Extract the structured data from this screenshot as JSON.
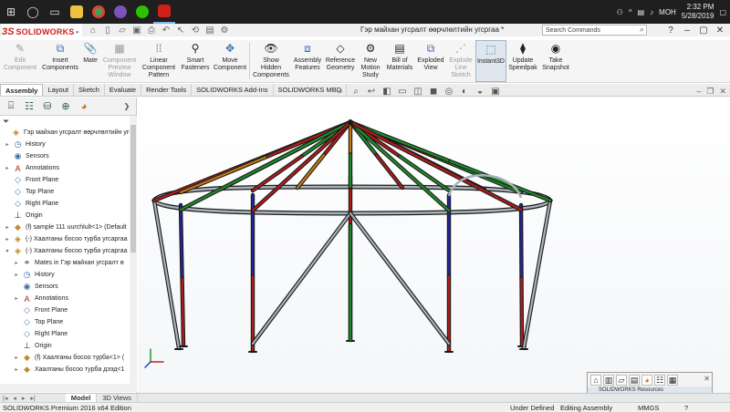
{
  "taskbar": {
    "apps": [
      {
        "name": "windows-start-icon",
        "color": "#ffffff"
      },
      {
        "name": "cortana-icon",
        "color": "#ffffff"
      },
      {
        "name": "task-view-icon",
        "color": "#ffffff"
      },
      {
        "name": "file-explorer-icon",
        "color": "#f0c040"
      },
      {
        "name": "chrome-icon",
        "color": "#3aa757"
      },
      {
        "name": "viber-icon",
        "color": "#7d52b8"
      },
      {
        "name": "wechat-icon",
        "color": "#2dc100"
      },
      {
        "name": "solidworks-icon",
        "color": "#d0201c"
      }
    ],
    "tray": {
      "lang": "MOH",
      "time": "2:32 PM",
      "date": "5/28/2019"
    }
  },
  "window": {
    "brand": "SOLIDWORKS",
    "title": "Гэр майхан угсралт өөрчлөлтийн угсргаа *",
    "search_placeholder": "Search Commands"
  },
  "ribbon": {
    "buttons": [
      {
        "id": "edit-component",
        "label": "Edit Component",
        "icon": "pencil-icon",
        "disabled": true
      },
      {
        "id": "insert-components",
        "label": "Insert Components",
        "icon": "insert-component-icon",
        "disabled": false
      },
      {
        "id": "mate",
        "label": "Mate",
        "icon": "paperclip-icon",
        "disabled": false
      },
      {
        "id": "component-preview",
        "label": "Component Preview Window",
        "icon": "preview-window-icon",
        "disabled": true
      },
      {
        "id": "linear-pattern",
        "label": "Linear Component Pattern",
        "icon": "linear-pattern-icon",
        "disabled": false
      },
      {
        "id": "smart-fasteners",
        "label": "Smart Fasteners",
        "icon": "fastener-icon",
        "disabled": false
      },
      {
        "id": "move-component",
        "label": "Move Component",
        "icon": "move-component-icon",
        "disabled": false
      },
      {
        "id": "show-hidden",
        "label": "Show Hidden Components",
        "icon": "show-hidden-icon",
        "disabled": false
      },
      {
        "id": "assembly-features",
        "label": "Assembly Features",
        "icon": "assembly-features-icon",
        "disabled": false
      },
      {
        "id": "reference-geometry",
        "label": "Reference Geometry",
        "icon": "reference-geometry-icon",
        "disabled": false
      },
      {
        "id": "new-motion-study",
        "label": "New Motion Study",
        "icon": "motion-study-icon",
        "disabled": false
      },
      {
        "id": "bill-of-materials",
        "label": "Bill of Materials",
        "icon": "bom-icon",
        "disabled": false
      },
      {
        "id": "exploded-view",
        "label": "Exploded View",
        "icon": "exploded-view-icon",
        "disabled": false
      },
      {
        "id": "explode-line-sketch",
        "label": "Explode Line Sketch",
        "icon": "explode-line-icon",
        "disabled": true
      },
      {
        "id": "instant3d",
        "label": "Instant3D",
        "icon": "instant3d-icon",
        "disabled": false,
        "active": true
      },
      {
        "id": "update-speedpak",
        "label": "Update Speedpak",
        "icon": "speedpak-icon",
        "disabled": false
      },
      {
        "id": "take-snapshot",
        "label": "Take Snapshot",
        "icon": "camera-icon",
        "disabled": false
      }
    ]
  },
  "command_tabs": [
    "Assembly",
    "Layout",
    "Sketch",
    "Evaluate",
    "Render Tools",
    "SOLIDWORKS Add-Ins",
    "SOLIDWORKS MBD"
  ],
  "command_tab_selected": 0,
  "tree": {
    "items": [
      {
        "label": "Гэр майхан угсралт өөрчлөлтийн угса",
        "level": 0,
        "expander": "",
        "icon": "assembly-icon"
      },
      {
        "label": "History",
        "level": 1,
        "expander": "▸",
        "icon": "history-icon"
      },
      {
        "label": "Sensors",
        "level": 1,
        "expander": "",
        "icon": "sensor-icon"
      },
      {
        "label": "Annotations",
        "level": 1,
        "expander": "▸",
        "icon": "annotation-icon"
      },
      {
        "label": "Front Plane",
        "level": 1,
        "expander": "",
        "icon": "plane-icon"
      },
      {
        "label": "Top Plane",
        "level": 1,
        "expander": "",
        "icon": "plane-icon"
      },
      {
        "label": "Right Plane",
        "level": 1,
        "expander": "",
        "icon": "plane-icon"
      },
      {
        "label": "Origin",
        "level": 1,
        "expander": "",
        "icon": "origin-icon"
      },
      {
        "label": "(f) sample 111 uurchlult<1> (Default",
        "level": 1,
        "expander": "▸",
        "icon": "part-icon"
      },
      {
        "label": "(-) Хаалганы босоо турба угсаргаа",
        "level": 1,
        "expander": "▸",
        "icon": "subassembly-icon"
      },
      {
        "label": "(-) Хаалганы босоо турба угсаргаа",
        "level": 1,
        "expander": "▾",
        "icon": "subassembly-icon"
      },
      {
        "label": "Mates in Гэр майхан угсралт ө",
        "level": 2,
        "expander": "▸",
        "icon": "mates-icon"
      },
      {
        "label": "History",
        "level": 2,
        "expander": "▸",
        "icon": "history-icon"
      },
      {
        "label": "Sensors",
        "level": 2,
        "expander": "",
        "icon": "sensor-icon"
      },
      {
        "label": "Annotations",
        "level": 2,
        "expander": "▸",
        "icon": "annotation-icon"
      },
      {
        "label": "Front Plane",
        "level": 2,
        "expander": "",
        "icon": "plane-icon"
      },
      {
        "label": "Top Plane",
        "level": 2,
        "expander": "",
        "icon": "plane-icon"
      },
      {
        "label": "Right Plane",
        "level": 2,
        "expander": "",
        "icon": "plane-icon"
      },
      {
        "label": "Origin",
        "level": 2,
        "expander": "",
        "icon": "origin-icon"
      },
      {
        "label": "(f) Хаалганы босоо турба<1> (",
        "level": 2,
        "expander": "▸",
        "icon": "part-icon"
      },
      {
        "label": "Хаалганы босоо турба дээд<1",
        "level": 2,
        "expander": "▸",
        "icon": "part-icon"
      }
    ]
  },
  "bottom_tabs": [
    "Model",
    "3D Views"
  ],
  "bottom_tab_selected": 0,
  "status": {
    "edition": "SOLIDWORKS Premium 2016 x64 Edition",
    "state": "Under Defined",
    "mode": "Editing Assembly",
    "units": "MMGS"
  },
  "task_pane": {
    "title": "SOLIDWORKS Resources"
  },
  "colors": {
    "frame": "#1a1a1a",
    "rafter_red": "#b01c1c",
    "rafter_green": "#1e8a2a",
    "rafter_orange": "#c07a12",
    "post_blue": "#22269a",
    "ring": "#a9b2ba",
    "brand": "#d0201c"
  }
}
